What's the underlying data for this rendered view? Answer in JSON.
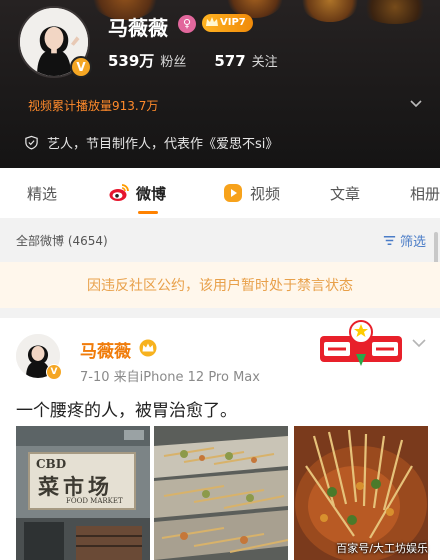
{
  "profile": {
    "name": "马薇薇",
    "vip_label": "VIP7",
    "followers_count": "539万",
    "followers_label": "粉丝",
    "following_count": "577",
    "following_label": "关注",
    "video_plays": "视频累计播放量913.7万",
    "identity": "艺人，节目制作人，代表作《爱思不si》",
    "verified_mark": "V",
    "gender_symbol": "♀"
  },
  "tabs": [
    {
      "label": "精选",
      "icon": "none"
    },
    {
      "label": "微博",
      "icon": "weibo-logo-icon",
      "active": true
    },
    {
      "label": "视频",
      "icon": "video-play-icon"
    },
    {
      "label": "文章",
      "icon": "none"
    },
    {
      "label": "相册",
      "icon": "none"
    }
  ],
  "feed": {
    "all_label": "全部微博 (4654)",
    "filter_label": "筛选"
  },
  "notice": "因违反社区公约，该用户暂时处于禁言状态",
  "post": {
    "author": "马薇薇",
    "meta": "7-10  来自iPhone 12 Pro Max",
    "text": "一个腰疼的人，被胃治愈了。",
    "images": [
      {
        "sign_top": "CBD",
        "sign_main": "菜市场",
        "sign_sub": "FOOD   MARKET"
      },
      {
        "subject": "skewers-counter"
      },
      {
        "subject": "hotpot-skewers"
      }
    ],
    "watermark": "百家号/大工坊娱乐"
  },
  "colors": {
    "header_bg": "#1c1a1a",
    "accent_orange": "#ff8200",
    "name_orange": "#f07c0a",
    "notice_text": "#e8a04a",
    "notice_bg": "#fff7ec",
    "filter_blue": "#4a7cc7",
    "vip_gold": "#f5a623"
  }
}
